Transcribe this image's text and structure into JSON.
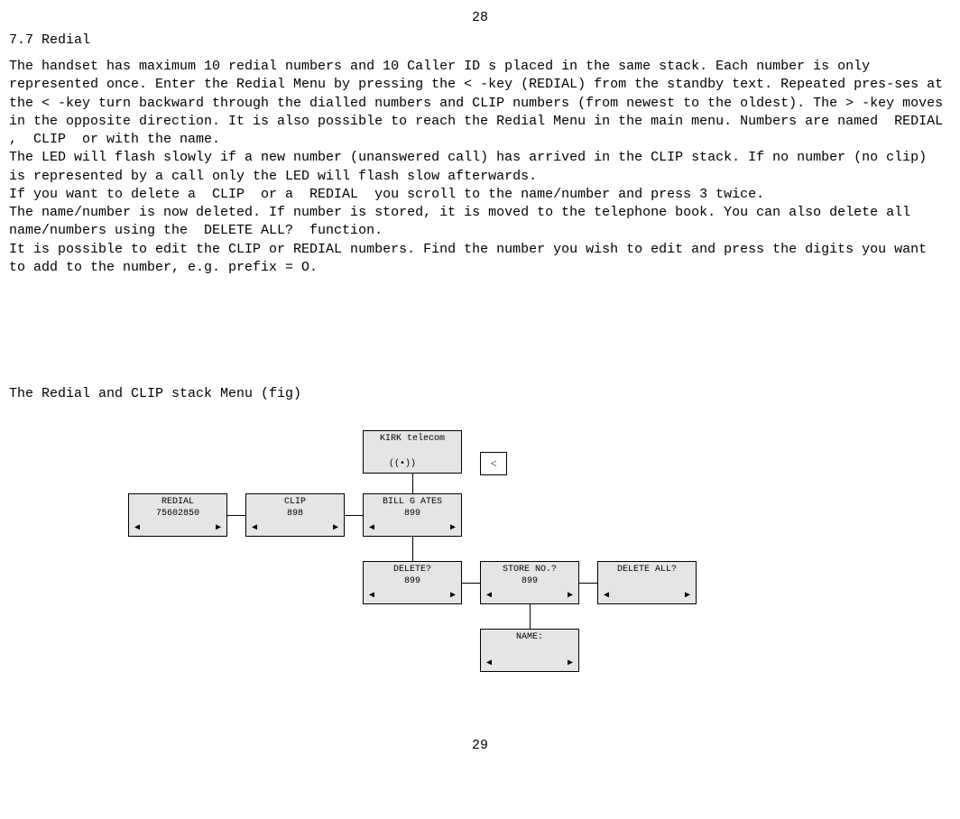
{
  "page_top": "28",
  "section_title": "7.7 Redial",
  "paragraphs": [
    "The handset has maximum 10 redial numbers and 10 Caller ID s placed in the same stack. Each number is only represented once. Enter the Redial Menu by pressing the < -key (REDIAL) from the standby text. Repeated pres-ses at the < -key turn backward through the dialled numbers and CLIP numbers (from newest to the oldest). The > -key moves in the opposite direction. It is also possible to reach the Redial Menu in the main menu. Numbers are named  REDIAL ,  CLIP  or with the name.",
    "The LED will flash slowly if a new number (unanswered call) has arrived in the CLIP stack. If no number (no clip) is represented by a call only the LED will flash slow afterwards.",
    "If you want to delete a  CLIP  or a  REDIAL  you scroll to the name/number and press 3 twice.",
    "The name/number is now deleted. If number is stored, it is moved to the telephone book. You can also delete all name/numbers using the  DELETE ALL?  function.",
    "It is possible to edit the CLIP or REDIAL numbers. Find the number you wish to edit and press the digits you want to add to the number, e.g. prefix = O."
  ],
  "fig_caption": "The Redial and CLIP stack Menu (fig)",
  "key_label": "<",
  "boxes": {
    "kirk": {
      "l1": "KIRK telecom",
      "l2": ""
    },
    "redial": {
      "l1": "REDIAL",
      "l2": "75602850"
    },
    "clip": {
      "l1": "CLIP",
      "l2": "898"
    },
    "billgates": {
      "l1": "BILL G ATES",
      "l2": "899"
    },
    "delete": {
      "l1": "DELETE?",
      "l2": "899"
    },
    "storeno": {
      "l1": "STORE NO.?",
      "l2": "899"
    },
    "deleteall": {
      "l1": "DELETE  ALL?",
      "l2": ""
    },
    "name": {
      "l1": "NAME:",
      "l2": ""
    }
  },
  "signal_glyph": "((•))",
  "tri_left": "◀",
  "tri_right": "▶",
  "page_bottom": "29"
}
